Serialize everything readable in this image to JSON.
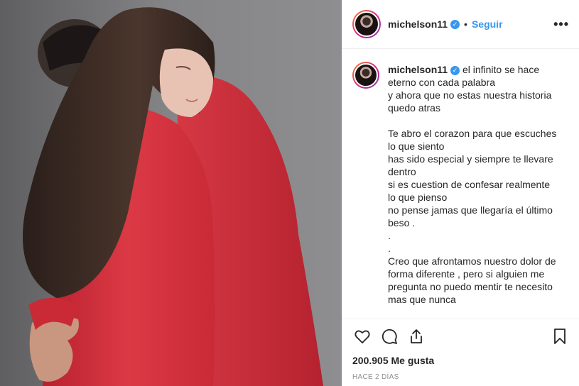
{
  "post": {
    "username": "michelson11",
    "verified_icon": "verified-badge-icon",
    "separator": "•",
    "follow_label": "Seguir",
    "more_icon": "more-options-icon",
    "more_label": "•••"
  },
  "caption": {
    "username": "michelson11",
    "text": "el infinito se hace eterno con cada palabra\ny ahora que no estas nuestra historia quedo atras\n\nTe abro el corazon para que escuches lo que siento\nhas sido especial y siempre te llevare dentro\nsi es cuestion de confesar realmente lo que pienso\nno pense jamas que llegaría el último beso .\n.\n.\nCreo que afrontamos nuestro dolor de forma diferente , pero si alguien me pregunta no puedo mentir te necesito mas que nunca"
  },
  "actions": {
    "like_icon": "heart-icon",
    "comment_icon": "comment-icon",
    "share_icon": "share-icon",
    "save_icon": "bookmark-icon"
  },
  "likes_text": "200.905 Me gusta",
  "timestamp": "HACE 2 DÍAS",
  "colors": {
    "link_blue": "#3897f0",
    "text": "#262626",
    "muted": "#8e8e8e",
    "sweater_red": "#d6353f"
  }
}
